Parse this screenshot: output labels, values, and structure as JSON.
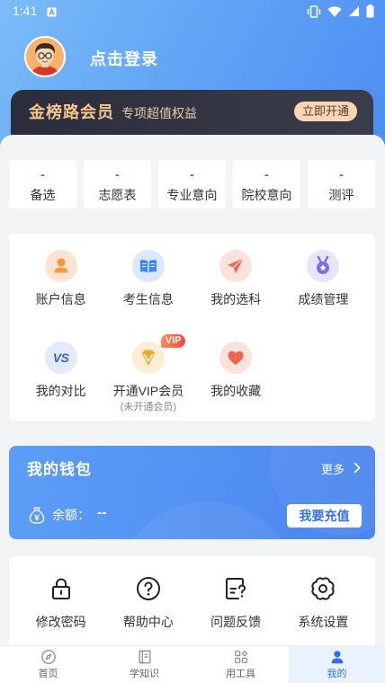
{
  "status_bar": {
    "time": "1:41"
  },
  "profile": {
    "login_text": "点击登录",
    "avatar": "avatar-icon"
  },
  "vip_banner": {
    "title": "金榜路会员",
    "subtitle": "专项超值权益",
    "button": "立即开通"
  },
  "stats": [
    {
      "value": "-",
      "label": "备选"
    },
    {
      "value": "-",
      "label": "志愿表"
    },
    {
      "value": "-",
      "label": "专业意向"
    },
    {
      "value": "-",
      "label": "院校意向"
    },
    {
      "value": "-",
      "label": "测评"
    }
  ],
  "menu": [
    {
      "label": "账户信息",
      "icon": "person-icon"
    },
    {
      "label": "考生信息",
      "icon": "book-icon"
    },
    {
      "label": "我的选科",
      "icon": "paper-plane-icon"
    },
    {
      "label": "成绩管理",
      "icon": "medal-icon"
    },
    {
      "label": "我的对比",
      "icon": "vs-icon",
      "icon_text": "VS"
    },
    {
      "label": "开通VIP会员",
      "sublabel": "(未开通会员)",
      "icon": "diamond-icon",
      "badge": "VIP"
    },
    {
      "label": "我的收藏",
      "icon": "heart-icon"
    }
  ],
  "wallet": {
    "title": "我的钱包",
    "more": "更多",
    "icon": "money-bag-icon",
    "balance_label": "余额：",
    "balance_value": "--",
    "recharge_button": "我要充值"
  },
  "tools": [
    {
      "label": "修改密码",
      "icon": "lock-icon"
    },
    {
      "label": "帮助中心",
      "icon": "help-icon"
    },
    {
      "label": "问题反馈",
      "icon": "feedback-icon"
    },
    {
      "label": "系统设置",
      "icon": "gear-icon"
    }
  ],
  "tab_bar": {
    "active": "我的",
    "items": [
      {
        "label": "首页",
        "icon": "compass-icon"
      },
      {
        "label": "学知识",
        "icon": "book-icon"
      },
      {
        "label": "用工具",
        "icon": "apps-icon"
      },
      {
        "label": "我的",
        "icon": "person-icon"
      }
    ]
  },
  "colors": {
    "header_gradient": [
      "#7cbcf8",
      "#4b8bf2"
    ],
    "primary": "#2f6fe8",
    "vip_gold": "#f3c48d",
    "vip_button": "#fad5b6",
    "stat_red": "#e53935",
    "wallet_gradient": [
      "#5c9ef7",
      "#4b85ee"
    ]
  }
}
